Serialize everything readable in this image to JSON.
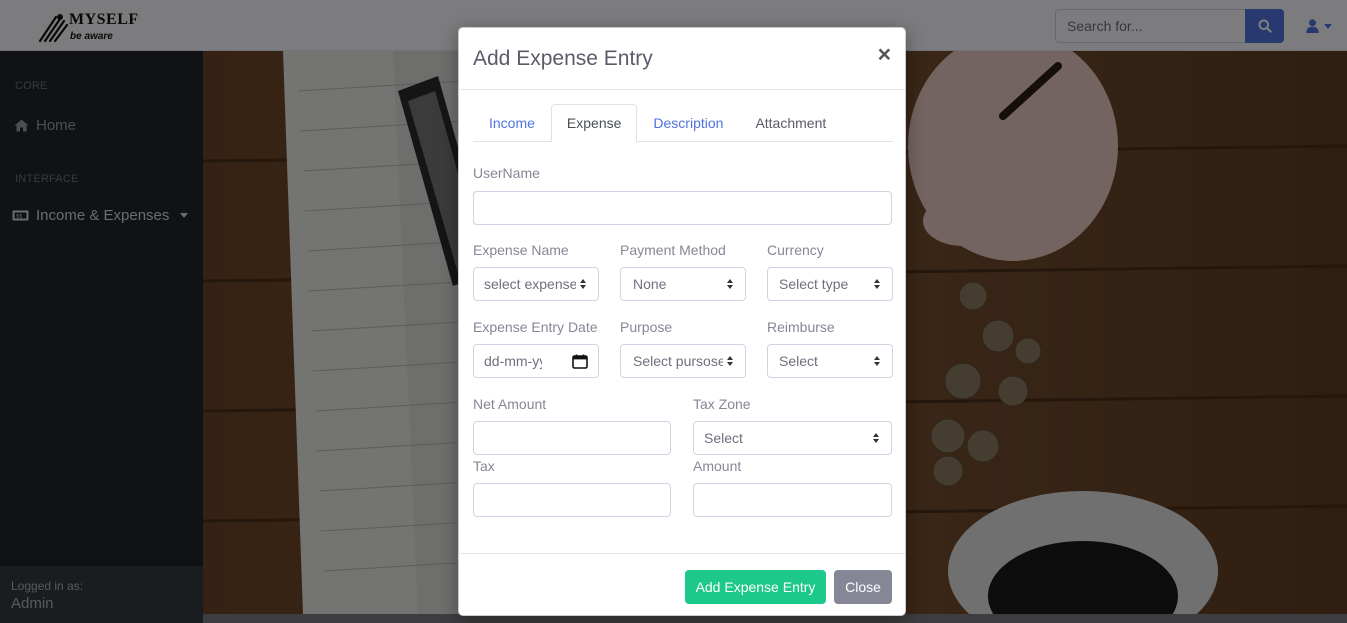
{
  "app": {
    "brand_title": "MYSELF",
    "brand_subtitle": "be aware"
  },
  "topbar": {
    "search_placeholder": "Search for..."
  },
  "sidebar": {
    "sections": [
      {
        "heading": "CORE",
        "items": [
          {
            "label": "Home",
            "icon": "home-icon"
          }
        ]
      },
      {
        "heading": "INTERFACE",
        "items": [
          {
            "label": "Income & Expenses",
            "icon": "money-bill-icon",
            "has_dropdown": true
          }
        ]
      }
    ],
    "footer": {
      "caption": "Logged in as:",
      "user": "Admin"
    }
  },
  "modal": {
    "title": "Add Expense Entry",
    "close_symbol": "×",
    "tabs": [
      {
        "label": "Income",
        "active": false
      },
      {
        "label": "Expense",
        "active": true
      },
      {
        "label": "Description",
        "active": false
      },
      {
        "label": "Attachment",
        "active": false
      }
    ],
    "fields": {
      "username": {
        "label": "UserName",
        "value": ""
      },
      "expense_name": {
        "label": "Expense Name",
        "value": "select expense"
      },
      "payment_method": {
        "label": "Payment Method",
        "value": "None"
      },
      "currency": {
        "label": "Currency",
        "value": "Select type"
      },
      "expense_entry_date": {
        "label": "Expense Entry Date",
        "value": "dd-mm-yyyy"
      },
      "purpose": {
        "label": "Purpose",
        "value": "Select pursose"
      },
      "reimburse": {
        "label": "Reimburse",
        "value": "Select"
      },
      "net_amount": {
        "label": "Net Amount",
        "value": ""
      },
      "tax_zone": {
        "label": "Tax Zone",
        "value": "Select"
      },
      "tax": {
        "label": "Tax",
        "value": ""
      },
      "amount": {
        "label": "Amount",
        "value": ""
      }
    },
    "buttons": {
      "submit": "Add Expense Entry",
      "close": "Close"
    }
  },
  "colors": {
    "primary": "#4e73df",
    "success": "#1cc88a",
    "secondary": "#858796",
    "sidebar": "#212529"
  }
}
